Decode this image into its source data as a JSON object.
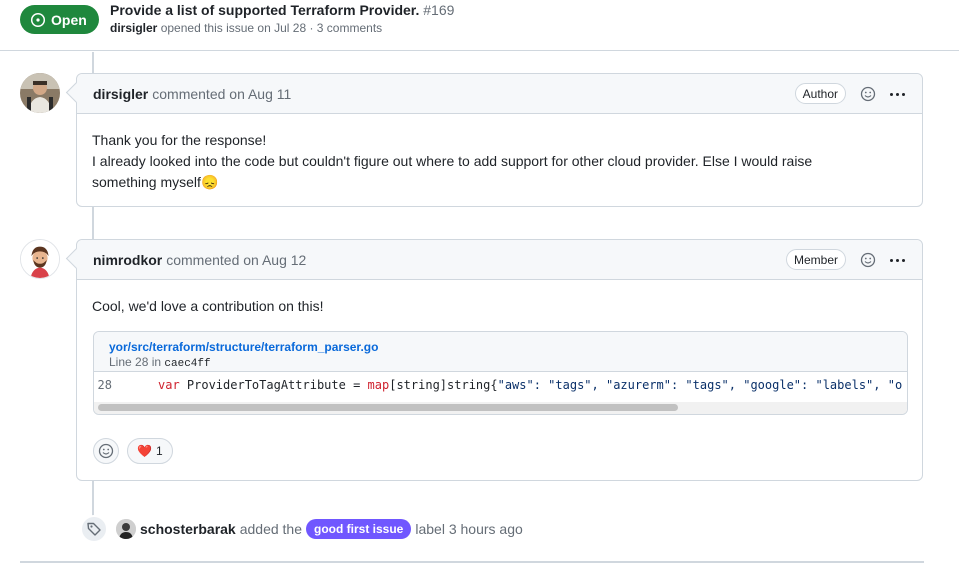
{
  "issue": {
    "state": "Open",
    "title": "Provide a list of supported Terraform Provider.",
    "number": "#169",
    "author": "dirsigler",
    "opened_text": "opened this issue on Jul 28 · 3 comments"
  },
  "comments": [
    {
      "author": "dirsigler",
      "when": "commented on Aug 11",
      "role": "Author",
      "body": [
        "Thank you for the response!",
        "I already looked into the code but couldn't figure out where to add support for other cloud provider. Else I would raise",
        "something myself"
      ],
      "emoji": "😞"
    },
    {
      "author": "nimrodkor",
      "when": "commented on Aug 12",
      "role": "Member",
      "body": [
        "Cool, we'd love a contribution on this!"
      ],
      "snippet": {
        "path": "yor/src/terraform/structure/terraform_parser.go",
        "line_text": "Line 28 in",
        "sha": "caec4ff",
        "line_number": "28",
        "code_kw1": "var",
        "code_ident": " ProviderToTagAttribute = ",
        "code_kw2": "map",
        "code_type": "[string]string{",
        "code_rest": "\"aws\": \"tags\", \"azurerm\": \"tags\", \"google\": \"labels\", \"o"
      },
      "reactions": [
        {
          "emoji": "❤️",
          "count": "1"
        }
      ]
    }
  ],
  "event": {
    "actor": "schosterbarak",
    "action": "added the",
    "label": "good first issue",
    "tail": "label 3 hours ago",
    "label_color": "#7057ff"
  },
  "colors": {
    "open_green": "#1f883d",
    "link_blue": "#0969da",
    "border": "#d0d7de"
  }
}
